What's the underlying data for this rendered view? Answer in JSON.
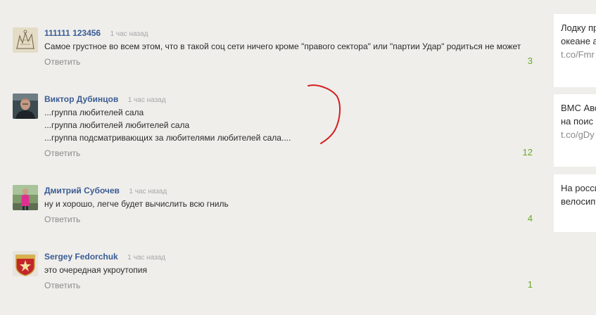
{
  "comments": [
    {
      "author": "111111 123456",
      "time": "1 час назад",
      "lines": [
        "Самое грустное во всем этом, что в такой соц сети ничего кроме \"правого сектора\" или \"партии Удар\" родиться не может"
      ],
      "reply": "Ответить",
      "count": "3",
      "avatar": "sketch-avatar"
    },
    {
      "author": "Виктор Дубинцов",
      "time": "1 час назад",
      "lines": [
        "...группа любителей сала",
        "...группа любителей любителей сала",
        "...группа подсматривающих за любителями любителей сала...."
      ],
      "reply": "Ответить",
      "count": "12",
      "avatar": "man-portrait-avatar"
    },
    {
      "author": "Дмитрий Субочев",
      "time": "1 час назад",
      "lines": [
        "ну и хорошо, легче будет вычислить всю гниль"
      ],
      "reply": "Ответить",
      "count": "4",
      "avatar": "person-pink-shirt-avatar"
    },
    {
      "author": "Sergey Fedorchuk",
      "time": "1 час назад",
      "lines": [
        "это очередная укроутопия"
      ],
      "reply": "Ответить",
      "count": "1",
      "avatar": "red-star-badge-avatar"
    }
  ],
  "sidebar": {
    "cards": [
      {
        "lines": [
          "Лодку пр",
          "океане а"
        ],
        "link": "t.co/Fmr"
      },
      {
        "lines": [
          "ВМС Авс",
          "на поис"
        ],
        "link": "t.co/gDy"
      },
      {
        "lines": [
          "На росси",
          "велосип"
        ],
        "link": ""
      }
    ]
  },
  "colors": {
    "background": "#efeeeb",
    "author": "#3a5c94",
    "count": "#6aa625",
    "annotation": "#d42020"
  }
}
